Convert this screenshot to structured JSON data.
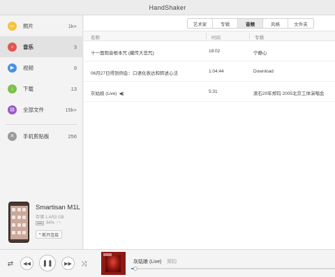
{
  "app": {
    "title": "HandShaker"
  },
  "sidebar": {
    "items": [
      {
        "label": "照片",
        "count": "1k+",
        "icon": "photo-icon",
        "color": "#f5c33b",
        "glyph": "▭"
      },
      {
        "label": "音乐",
        "count": "3",
        "icon": "music-icon",
        "color": "#e2554f",
        "glyph": "♪"
      },
      {
        "label": "视频",
        "count": "9",
        "icon": "video-icon",
        "color": "#4a90e2",
        "glyph": "▶"
      },
      {
        "label": "下载",
        "count": "13",
        "icon": "download-icon",
        "color": "#7dc24b",
        "glyph": "↓"
      },
      {
        "label": "全部文件",
        "count": "15k+",
        "icon": "folder-icon",
        "color": "#9b59c6",
        "glyph": "▤"
      },
      {
        "label": "手机剪贴板",
        "count": "256",
        "icon": "clipboard-icon",
        "color": "#9a9a9a",
        "glyph": "✕"
      }
    ],
    "active_index": 1
  },
  "device": {
    "name": "Smartisan M1L",
    "storage": "存储 1.4/53 GB",
    "battery": "94%",
    "button_label": "断开连接"
  },
  "tabs": [
    "艺术家",
    "专辑",
    "音频",
    "风格",
    "文件夹"
  ],
  "active_tab": 2,
  "table": {
    "headers": [
      "名称",
      "时间",
      "专辑"
    ],
    "rows": [
      {
        "name": "十一面观音根本咒 (藏传大悲咒)",
        "time": "18:02",
        "album": "宁静心"
      },
      {
        "name": "06月27日得到例会：口语化表达和转述心法",
        "time": "1:04:44",
        "album": "Download"
      },
      {
        "name": "灰姑娘 (Live)",
        "time": "5:31",
        "album": "滚石20年郑钧 2005北京工体演唱会",
        "playing": true
      }
    ]
  },
  "player": {
    "title": "灰姑娘 (Live)",
    "artist": "郑钧",
    "progress": 0.02
  }
}
